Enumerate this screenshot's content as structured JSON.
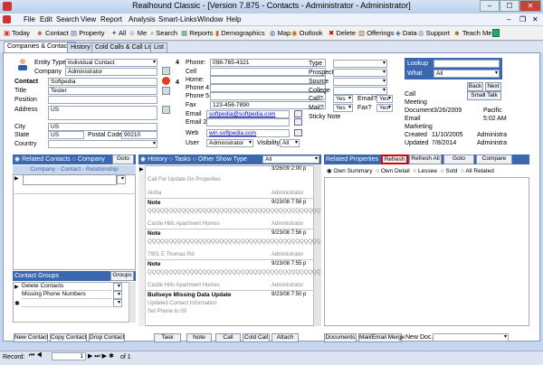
{
  "window": {
    "title": "Realhound Classic - [Version 7.875 - Contacts - Administrator - Administrator]",
    "min": "–",
    "max": "☐",
    "close": "✕"
  },
  "menu": [
    "File",
    "Edit",
    "Search",
    "View",
    "Report",
    "Analysis",
    "Smart-Links",
    "Window",
    "Help"
  ],
  "toolbar": [
    "Today",
    "Contact",
    "Property",
    "All",
    "Me",
    "Search",
    "Reports",
    "Demographics",
    "Map",
    "Outlook",
    "Delete",
    "Offerings",
    "Data",
    "Support",
    "Teach Me"
  ],
  "tabs": [
    "Companies & Contacts",
    "History",
    "Cold Calls & Call Lists",
    "List"
  ],
  "contact": {
    "entity_type_label": "Entity Type",
    "entity_type": "Individual Contact",
    "company_label": "Company",
    "company": "Administrator",
    "contact_label": "Contact",
    "contact": "Softpedia",
    "title_label": "Title",
    "title": "Tester",
    "position_label": "Position",
    "position": "",
    "address_label": "Address",
    "address": "US",
    "city_label": "City",
    "city": "US",
    "state_label": "State",
    "state": "US",
    "postal_label": "Postal Code",
    "postal": "90210",
    "country_label": "Country",
    "country": ""
  },
  "phones": {
    "phone_label": "Phone:",
    "phone": "098-765-4321",
    "cell_label": "Cell",
    "home_label": "Home:",
    "phone4_label": "Phone 4:",
    "phone5_label": "Phone 5:",
    "fax_label": "Fax",
    "fax": "123-456-7890",
    "email_label": "Email",
    "email": "softpedia@softpedia.com",
    "email2_label": "Email 2",
    "web_label": "Web",
    "web": "win.softpedia.com",
    "user_label": "User",
    "user": "Administrator",
    "visibility_label": "Visibility",
    "visibility": "All"
  },
  "type_section": {
    "type_label": "Type",
    "prospect_label": "Prospect",
    "source_label": "Source",
    "college_label": "College",
    "call_label": "Call?",
    "call": "Yes",
    "email_label": "Email?",
    "email": "Yes",
    "mail_label": "Mail?",
    "mail": "Yes",
    "fax_label": "Fax?",
    "fax": "Yes",
    "sticky_label": "Sticky Note"
  },
  "lookup": {
    "lookup_label": "Lookup",
    "what_label": "What",
    "what": "All",
    "back": "Back",
    "next": "Next",
    "small_talk": "Small Talk"
  },
  "meta": {
    "call_label": "Call",
    "meeting_label": "Meeting",
    "document_label": "Document",
    "document": "3/26/2009",
    "document_tz": "Pacific",
    "email_label": "Email",
    "email": "5:02 AM",
    "marketing_label": "Marketing",
    "created_label": "Created",
    "created": "11/10/2005",
    "created_by": "Administra",
    "updated_label": "Updated",
    "updated": "7/8/2014",
    "updated_by": "Administra"
  },
  "related_contacts": {
    "head": "Related Contacts",
    "company": "Company",
    "goto": "Goto",
    "subhead": "Company - Contact - Relationship"
  },
  "history_bar": {
    "history": "History",
    "tasks": "Tasks",
    "other": "Other",
    "show_type": "Show Type",
    "show_value": "All"
  },
  "history_items": [
    {
      "date": "3/26/09 2:00 p",
      "title": "",
      "text": "Call For Update On Properties",
      "sub": "Aloha",
      "user": "Administrator"
    },
    {
      "date": "9/23/08 7:56 p",
      "title": "Note",
      "text": "QQQQQQQQQQQQQQQQQQQQQQQQQQQQQQQQQQQQQQQQQ",
      "sub": "Castle Hills Apartment Homes",
      "user": "Administrator"
    },
    {
      "date": "9/23/08 7:56 p",
      "title": "Note",
      "text": "QQQQQQQQQQQQQQQQQQQQQQQQQQQQQQQQQQQQQQQQQ",
      "sub": "7901 E Thomas Rd",
      "user": "Administrator"
    },
    {
      "date": "9/23/08 7:55 p",
      "title": "Note",
      "text": "QQQQQQQQQQQQQQQQQQQQQQQQQQQQQQQQQQQQQQQQQ",
      "sub": "Castle Hills Apartment Homes",
      "user": "Administrator"
    },
    {
      "date": "9/23/08 7:50 p",
      "title": "Bullseye Missing Data Update",
      "text": "Updated Contact Information",
      "sub": "Set Phone to 00",
      "user": ""
    }
  ],
  "related_props": {
    "head": "Related Properties",
    "refresh": "Refresh",
    "refresh_all": "Refresh All",
    "goto": "Goto",
    "compare": "Compare",
    "radios": [
      "Own Summary",
      "Own Detail",
      "Lessee",
      "Sold",
      "All Related"
    ]
  },
  "contact_groups": {
    "head": "Contact Groups",
    "groups_btn": "Groups",
    "rows": [
      "Delete Contacts",
      "Missing Phone Numbers",
      ""
    ]
  },
  "bottom_left": [
    "New Contact",
    "Copy Contact",
    "Drop Contact"
  ],
  "bottom_mid": [
    "Task",
    "Note",
    "Call",
    "Cold Call",
    "Attach"
  ],
  "bottom_right": {
    "documents": "Documents",
    "mail_merge": "Mail/Email Merge",
    "new_doc": "New Doc."
  },
  "status": {
    "record_label": "Record:",
    "record": "1",
    "of": "of 1"
  }
}
